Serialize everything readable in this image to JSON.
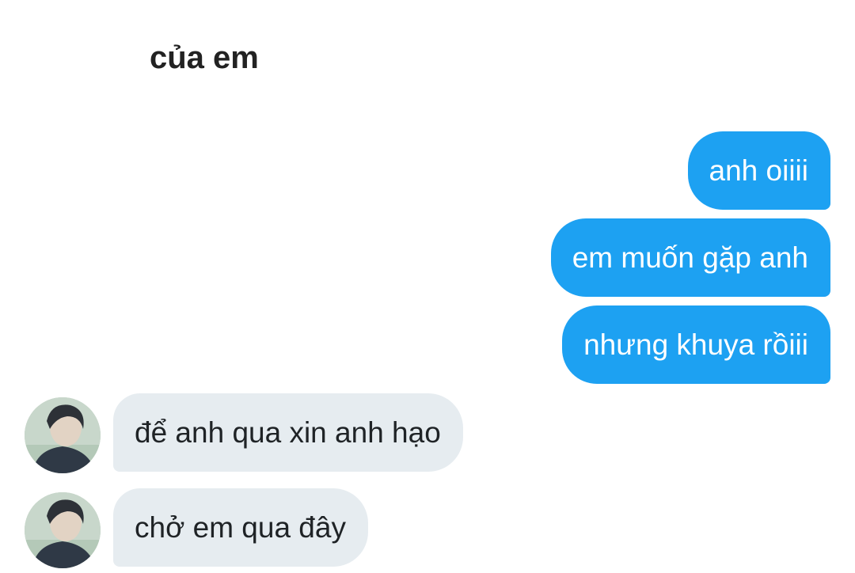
{
  "conversation": {
    "title": "của em"
  },
  "messages": [
    {
      "direction": "out",
      "text": "anh oiiii"
    },
    {
      "direction": "out",
      "text": "em muốn gặp anh"
    },
    {
      "direction": "out",
      "text": "nhưng khuya rồiii"
    },
    {
      "direction": "in",
      "text": "để anh qua xin anh hạo",
      "avatar": "profile-photo"
    },
    {
      "direction": "in",
      "text": "chở em qua đây",
      "avatar": "profile-photo"
    }
  ],
  "colors": {
    "outgoing_bubble": "#1da1f2",
    "incoming_bubble": "#e6ecf0",
    "outgoing_text": "#ffffff",
    "incoming_text": "#1f2326",
    "title_text": "#222222"
  }
}
